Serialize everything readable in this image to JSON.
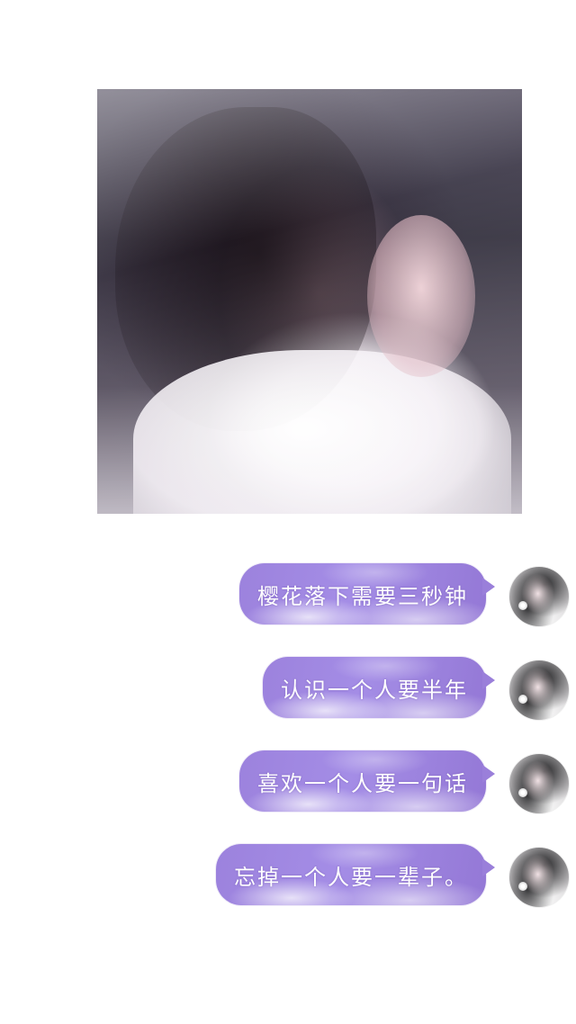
{
  "photo": {
    "description_icon": "portrait-photo"
  },
  "messages": [
    {
      "text": "樱花落下需要三秒钟"
    },
    {
      "text": "认识一个人要半年"
    },
    {
      "text": "喜欢一个人要一句话"
    },
    {
      "text": "忘掉一个人要一辈子。"
    }
  ],
  "colors": {
    "bubble": "#9c82dd",
    "background": "#ffffff",
    "text": "#ffffff"
  }
}
